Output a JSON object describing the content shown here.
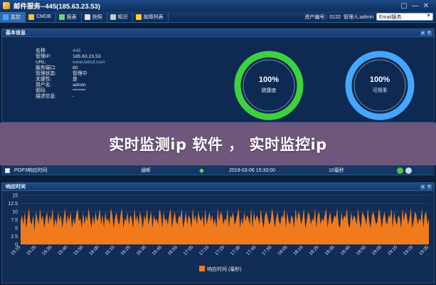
{
  "window": {
    "title": "邮件服务--445(185.63.23.53)",
    "controls": [
      "▢",
      "—",
      "✕"
    ]
  },
  "tabs": [
    {
      "label": "监控",
      "color": "#4aa3ff",
      "active": true
    },
    {
      "label": "CMDB",
      "color": "#f0c040",
      "active": false
    },
    {
      "label": "报表",
      "color": "#6fd06f",
      "active": false
    },
    {
      "label": "快照",
      "color": "#e0e0e0",
      "active": false
    },
    {
      "label": "知识",
      "color": "#c8c8c8",
      "active": false
    },
    {
      "label": "故障列表",
      "color": "#ffcc33",
      "active": false
    }
  ],
  "header_right": {
    "asset_no": "资产编号：0122",
    "admin": "管理人:admin",
    "dropdown_value": "Email服务"
  },
  "basic_info": {
    "panel_title": "基本信息",
    "rows": [
      {
        "key": "名称:",
        "value": "445",
        "link": true
      },
      {
        "key": "管理IP:",
        "value": "185.63.23.53",
        "link": false
      },
      {
        "key": "URL:",
        "value": "www.bdsd.com",
        "link": true
      },
      {
        "key": "服务端口:",
        "value": "80",
        "link": false
      },
      {
        "key": "管理状态:",
        "value": "管理中",
        "link": false
      },
      {
        "key": "关键性:",
        "value": "是",
        "link": false
      },
      {
        "key": "用户名:",
        "value": "admin",
        "link": false
      },
      {
        "key": "密码:",
        "value": "*******",
        "link": false
      },
      {
        "key": "描述信息:",
        "value": "-",
        "link": false
      }
    ]
  },
  "gauges": [
    {
      "percent_text": "100%",
      "label": "健康度",
      "value": 1.0,
      "color": "#3ed13e"
    },
    {
      "percent_text": "100%",
      "label": "可用率",
      "value": 1.0,
      "color": "#46a6ff"
    }
  ],
  "overlay_text": "实时监测ip 软件 ， 实时监控ip",
  "indicator_table": {
    "row": {
      "name": "POP3响应时间",
      "status": "通断",
      "time": "2019-03-06 15:33:00",
      "value": "10毫秒"
    }
  },
  "response_panel_title": "响应时间",
  "chart_data": {
    "type": "area",
    "title": "",
    "ylim": [
      0,
      15
    ],
    "yticks": [
      0,
      2.5,
      5,
      7.5,
      10,
      12.5,
      15
    ],
    "ytick_labels": [
      "0",
      "2.5",
      "5",
      "7.5",
      "10",
      "12.5",
      "15"
    ],
    "xtick_labels": [
      "15:15",
      "15:25",
      "15:35",
      "15:45",
      "15:55",
      "16:05",
      "16:15",
      "16:25",
      "16:35",
      "16:45",
      "16:55",
      "17:05",
      "17:15",
      "17:25",
      "17:35",
      "17:45",
      "17:55",
      "18:05",
      "18:15",
      "18:25",
      "18:35",
      "18:45",
      "18:55",
      "19:05",
      "19:15",
      "19:25",
      "19:35"
    ],
    "series": [
      {
        "name": "响应时间 (毫秒)",
        "color": "#f07a1c",
        "values": [
          7,
          9,
          6,
          10,
          5,
          8,
          11,
          7,
          6,
          9,
          4,
          10,
          8,
          6,
          11,
          7,
          9,
          5,
          8,
          10,
          6,
          9,
          7,
          11,
          5,
          8,
          6,
          10,
          7,
          9,
          5,
          8,
          11,
          6,
          9,
          7,
          10,
          5,
          8,
          6,
          9,
          11,
          7,
          8,
          5,
          10,
          6,
          9,
          7,
          11,
          8,
          5,
          9,
          6,
          10,
          7,
          8,
          11,
          6,
          9,
          5,
          10,
          7,
          8,
          6,
          11,
          9,
          5,
          8,
          10,
          7,
          6,
          9,
          11,
          5,
          8,
          7,
          10,
          6,
          9,
          8,
          5,
          11,
          7,
          9,
          6,
          10,
          8,
          5,
          9,
          7,
          11,
          6,
          8,
          10,
          5,
          9,
          7,
          8,
          6,
          11,
          9,
          5,
          10,
          7,
          8,
          6,
          9,
          11,
          5,
          8,
          10,
          7,
          6,
          9,
          8,
          11,
          5,
          7,
          10,
          6,
          9,
          8,
          5,
          11,
          7,
          9,
          6,
          10,
          8,
          7,
          9,
          5,
          11,
          6,
          8,
          10,
          7,
          9,
          6,
          8,
          5,
          11,
          7,
          10,
          9,
          6,
          8,
          7,
          11,
          5,
          9,
          8,
          10,
          6,
          7,
          9,
          11,
          5,
          8,
          6,
          10,
          7,
          9,
          8,
          6,
          11,
          5,
          10,
          7,
          9,
          8,
          6,
          11,
          7,
          5,
          9,
          10,
          8,
          6,
          7,
          11,
          9,
          5,
          8,
          10,
          7,
          6,
          9,
          8,
          11,
          5,
          10,
          7,
          6,
          9,
          8,
          5,
          11,
          7,
          10,
          9,
          6,
          8,
          11,
          5,
          7,
          10,
          9,
          6,
          8,
          7,
          11,
          5,
          9,
          10,
          6,
          8,
          7,
          9,
          11,
          5,
          8,
          10,
          6,
          7,
          9,
          8,
          11,
          6,
          5,
          10,
          7,
          9,
          8,
          11,
          6,
          5,
          10,
          7,
          9,
          8,
          6,
          11,
          7,
          5,
          10,
          9,
          8,
          6,
          11,
          7,
          5,
          9,
          10,
          8,
          6,
          7,
          11,
          9,
          5,
          8,
          10,
          7,
          6,
          9,
          8,
          11,
          5,
          10,
          7,
          6,
          9,
          8,
          5,
          11,
          7,
          10,
          9,
          6,
          8,
          11,
          5,
          7,
          10,
          9,
          6,
          8,
          7,
          11,
          5,
          9,
          10,
          6,
          8
        ]
      }
    ],
    "legend_position": "bottom-center",
    "grid": true
  }
}
